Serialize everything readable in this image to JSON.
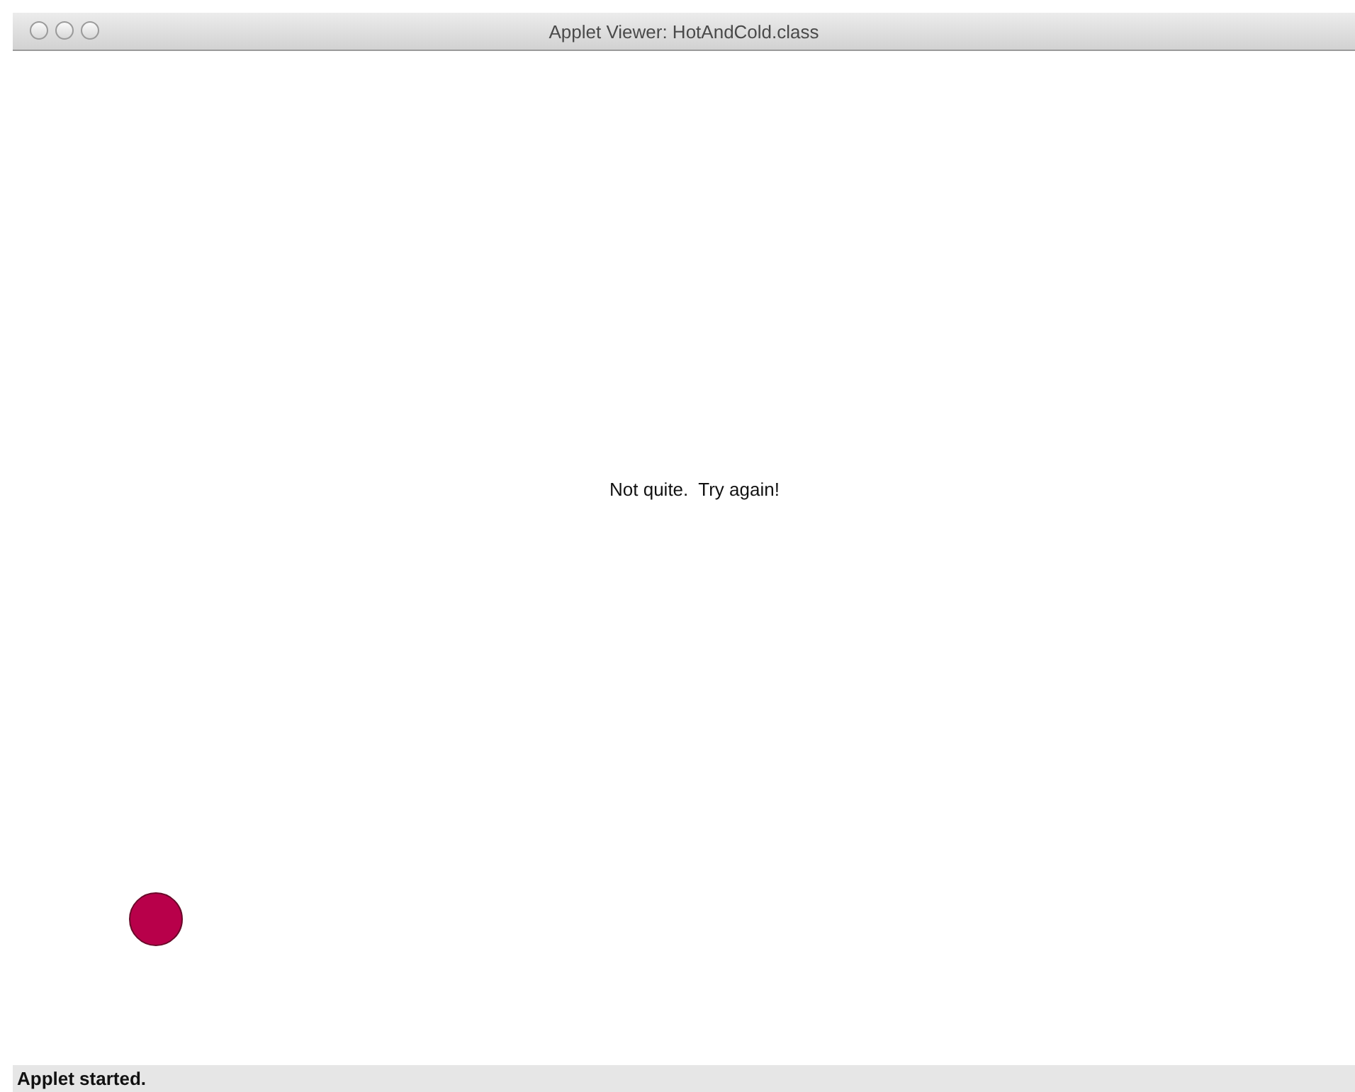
{
  "window": {
    "title": "Applet Viewer: HotAndCold.class"
  },
  "canvas": {
    "message": "Not quite.  Try again!"
  },
  "status_bar": {
    "text": "Applet started."
  }
}
